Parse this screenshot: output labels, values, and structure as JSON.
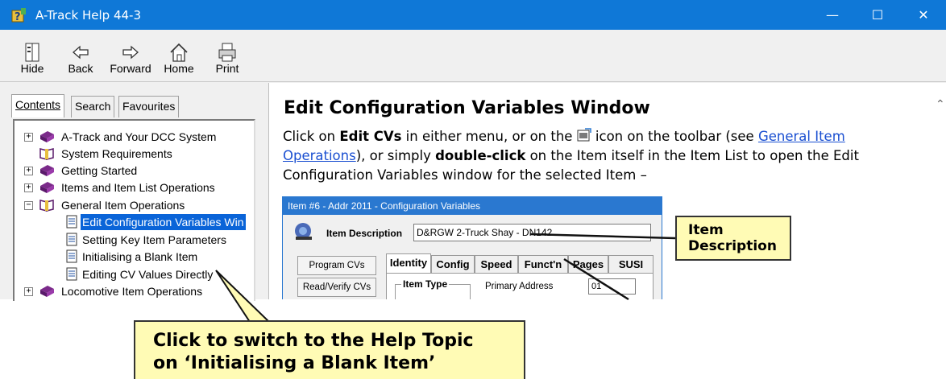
{
  "window": {
    "title": "A-Track Help 44-3",
    "controls": {
      "minimize": "—",
      "maximize": "☐",
      "close": "✕"
    }
  },
  "toolbar": [
    {
      "label": "Hide",
      "icon": "hide-icon"
    },
    {
      "label": "Back",
      "icon": "back-arrow-icon"
    },
    {
      "label": "Forward",
      "icon": "forward-arrow-icon"
    },
    {
      "label": "Home",
      "icon": "home-icon"
    },
    {
      "label": "Print",
      "icon": "printer-icon"
    }
  ],
  "nav_tabs": [
    "Contents",
    "Search",
    "Favourites"
  ],
  "tree": [
    {
      "label": "A-Track and Your DCC System",
      "expander": "+",
      "icon": "book-closed-icon"
    },
    {
      "label": "System Requirements",
      "expander": "",
      "icon": "book-open-icon"
    },
    {
      "label": "Getting Started",
      "expander": "+",
      "icon": "book-closed-icon"
    },
    {
      "label": "Items and Item List Operations",
      "expander": "+",
      "icon": "book-closed-icon"
    },
    {
      "label": "General Item Operations",
      "expander": "−",
      "icon": "book-open-icon"
    },
    {
      "label": "Edit Configuration Variables Win",
      "expander": "",
      "icon": "page-icon",
      "selected": true
    },
    {
      "label": "Setting Key Item Parameters",
      "expander": "",
      "icon": "page-icon"
    },
    {
      "label": "Initialising a Blank Item",
      "expander": "",
      "icon": "page-icon"
    },
    {
      "label": "Editing CV Values Directly",
      "expander": "",
      "icon": "page-icon"
    },
    {
      "label": "Locomotive Item Operations",
      "expander": "+",
      "icon": "book-closed-icon"
    }
  ],
  "content": {
    "heading": "Edit Configuration Variables Window",
    "p1": "Click on ",
    "b1": "Edit CVs",
    "p2": " in either menu, or on the ",
    "p3": " icon on the toolbar (see ",
    "link": "General Item Operations",
    "p4": "), or simply ",
    "b2": "double-click",
    "p5": " on the Item itself in the Item List to open the Edit Configuration Variables window for the selected Item –"
  },
  "cv_window": {
    "title": "Item #6 - Addr 2011 - Configuration Variables",
    "item_description_label": "Item Description",
    "item_description_value": "D&RGW 2-Truck Shay - DN142",
    "buttons": [
      "Program CVs",
      "Read/Verify CVs"
    ],
    "tabs": [
      "Identity",
      "Config",
      "Speed",
      "Funct'n",
      "Pages",
      "SUSI"
    ],
    "group_label": "Item Type",
    "primary_address_label": "Primary Address",
    "primary_address_value": "01"
  },
  "callouts": {
    "item_description": "Item Description",
    "help_topic_line1": "Click to switch to the Help Topic",
    "help_topic_line2": "on ‘Initialising a Blank Item’"
  },
  "colors": {
    "titlebar": "#0f78d7",
    "selection": "#0a64d8",
    "link": "#1a4fd1",
    "callout": "#fffbb5"
  }
}
